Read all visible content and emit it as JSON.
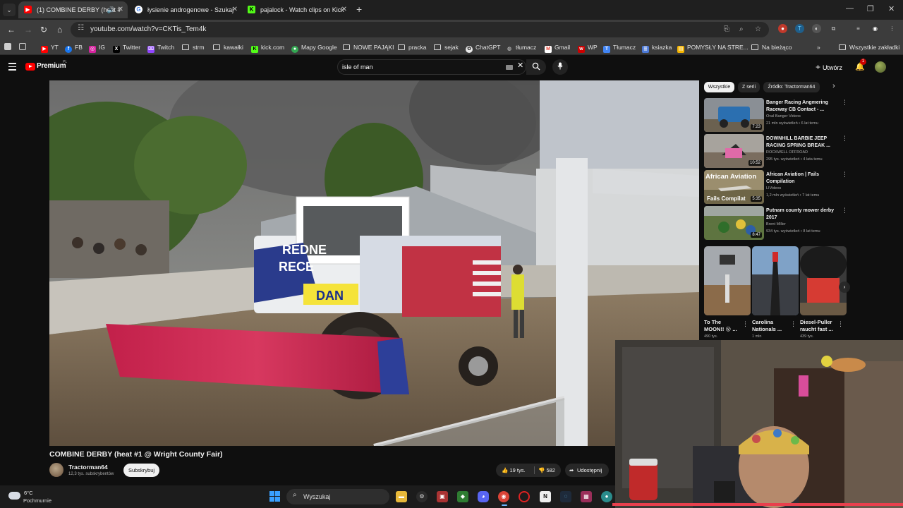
{
  "browser": {
    "tabs": [
      {
        "title": "(1) COMBINE DERBY (heat #",
        "active": true,
        "audio": true
      },
      {
        "title": "łysienie androgenowe - Szukaj",
        "active": false
      },
      {
        "title": "pajalock - Watch clips on Kick",
        "active": false
      }
    ],
    "url": "youtube.com/watch?v=CKTis_Tem4k",
    "bookmarks": [
      "YT",
      "FB",
      "IG",
      "Twitter",
      "Twitch",
      "strm",
      "kawałki",
      "kick.com",
      "Mapy Google",
      "NOWE PAJĄKI",
      "pracka",
      "sejak",
      "ChatGPT",
      "tłumacz",
      "Gmail",
      "WP",
      "Tłumacz",
      "ksiazka",
      "POMYSŁY NA STRE...",
      "Na bieżąco"
    ],
    "all_bookmarks": "Wszystkie zakładki"
  },
  "youtube": {
    "logo": "Premium",
    "region": "PL",
    "search_query": "isle of man",
    "create_label": "Utwórz",
    "notif_count": "1",
    "video": {
      "title": "COMBINE DERBY (heat #1 @ Wright County Fair)",
      "channel": "Tractorman64",
      "subs": "12,3 tys. subskrybentów",
      "subscribe_label": "Subskrybuj",
      "likes": "19 tys.",
      "dislikes": "582",
      "share": "Udostępnij"
    },
    "chips": [
      "Wszystkie",
      "Z serii",
      "Źródło: Tractorman64"
    ],
    "recommendations": [
      {
        "title": "Banger Racing Angmering Raceway CB Contact - ...",
        "channel": "Oval Banger Videos",
        "meta": "21 mln wyświetleń • 6 lat temu",
        "duration": "7:23"
      },
      {
        "title": "DOWNHILL BARBIE JEEP RACING SPRING BREAK ...",
        "channel": "ROCKWELL OFFROAD",
        "meta": "295 tys. wyświetleń • 4 lata temu",
        "duration": "10:52"
      },
      {
        "title": "African Aviation | Fails Compilation",
        "channel": "LIVideos",
        "meta": "1,2 mln wyświetleń • 7 lat temu",
        "duration": "5:35",
        "overlay": "African Aviation",
        "overlay2": "Fails Compilat"
      },
      {
        "title": "Putnam county mower derby 2017",
        "channel": "Brent Miller",
        "meta": "934 tys. wyświetleń • 8 lat temu",
        "duration": "8:47"
      }
    ],
    "shorts": [
      {
        "title": "To The MOON!! 😮 ...",
        "meta": "490 tys."
      },
      {
        "title": "Carolina Nationals ...",
        "meta": "1 mln"
      },
      {
        "title": "Diesel-Puller raucht fast ...",
        "meta": "439 tys."
      }
    ]
  },
  "video_frame_text": {
    "hood1": "REDNE",
    "hood2": "RECE",
    "plate": "DAN"
  },
  "taskbar": {
    "temp": "6°C",
    "condition": "Pochmurnie",
    "search": "Wyszukaj"
  }
}
